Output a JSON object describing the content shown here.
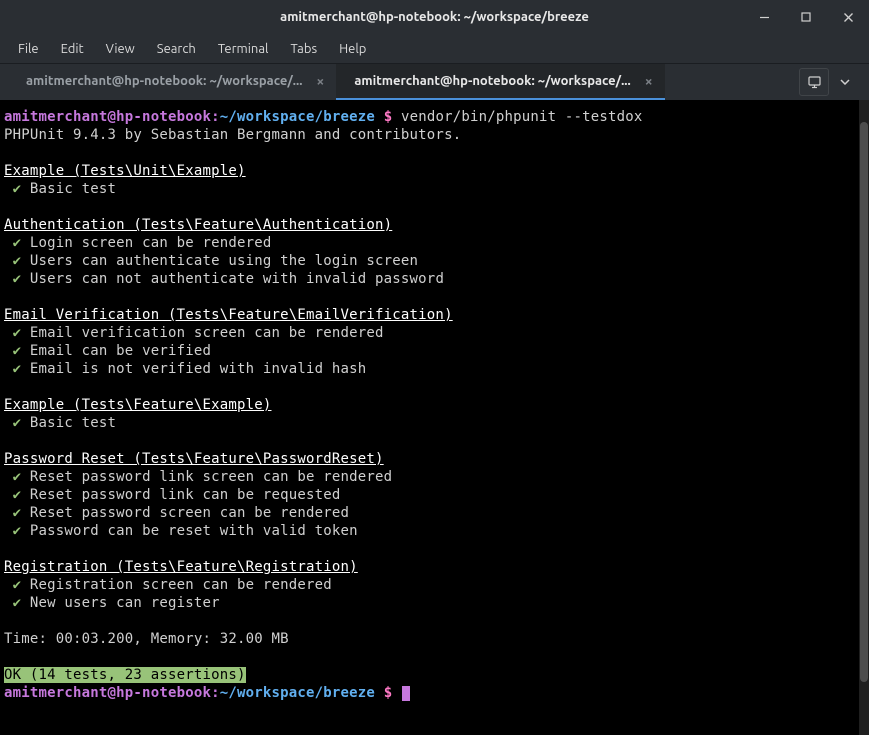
{
  "window": {
    "title": "amitmerchant@hp-notebook: ~/workspace/breeze"
  },
  "menu": {
    "file": "File",
    "edit": "Edit",
    "view": "View",
    "search": "Search",
    "terminal": "Terminal",
    "tabs": "Tabs",
    "help": "Help"
  },
  "tabs": {
    "tab1": "amitmerchant@hp-notebook: ~/workspace/...",
    "tab2": "amitmerchant@hp-notebook: ~/workspace/..."
  },
  "prompt": {
    "user": "amitmerchant@hp-notebook",
    "colon": ":",
    "path": "~/workspace/breeze",
    "dollar": " $ ",
    "command": "vendor/bin/phpunit --testdox"
  },
  "output": {
    "phpunit_line": "PHPUnit 9.4.3 by Sebastian Bergmann and contributors.",
    "check": " ✔ ",
    "groups": [
      {
        "heading": "Example (Tests\\Unit\\Example)",
        "tests": [
          "Basic test"
        ]
      },
      {
        "heading": "Authentication (Tests\\Feature\\Authentication)",
        "tests": [
          "Login screen can be rendered",
          "Users can authenticate using the login screen",
          "Users can not authenticate with invalid password"
        ]
      },
      {
        "heading": "Email Verification (Tests\\Feature\\EmailVerification)",
        "tests": [
          "Email verification screen can be rendered",
          "Email can be verified",
          "Email is not verified with invalid hash"
        ]
      },
      {
        "heading": "Example (Tests\\Feature\\Example)",
        "tests": [
          "Basic test"
        ]
      },
      {
        "heading": "Password Reset (Tests\\Feature\\PasswordReset)",
        "tests": [
          "Reset password link screen can be rendered",
          "Reset password link can be requested",
          "Reset password screen can be rendered",
          "Password can be reset with valid token"
        ]
      },
      {
        "heading": "Registration (Tests\\Feature\\Registration)",
        "tests": [
          "Registration screen can be rendered",
          "New users can register"
        ]
      }
    ],
    "time_memory": "Time: 00:03.200, Memory: 32.00 MB",
    "ok_line": "OK (14 tests, 23 assertions)"
  }
}
